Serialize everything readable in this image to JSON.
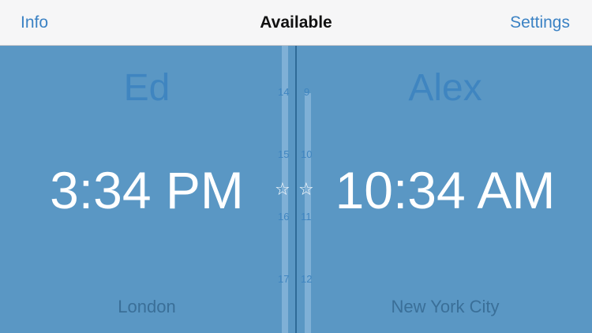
{
  "navbar": {
    "left_button": "Info",
    "title": "Available",
    "right_button": "Settings"
  },
  "left": {
    "name": "Ed",
    "time": "3:34 PM",
    "city": "London",
    "hours": [
      "14",
      "15",
      "16",
      "17"
    ]
  },
  "right": {
    "name": "Alex",
    "time": "10:34 AM",
    "city": "New York City",
    "hours": [
      "9",
      "10",
      "11",
      "12"
    ]
  },
  "icons": {
    "star": "☆"
  },
  "colors": {
    "background": "#5a97c4",
    "accent": "#3b82c4",
    "name": "#3f85c0",
    "city": "#3a6f98"
  }
}
